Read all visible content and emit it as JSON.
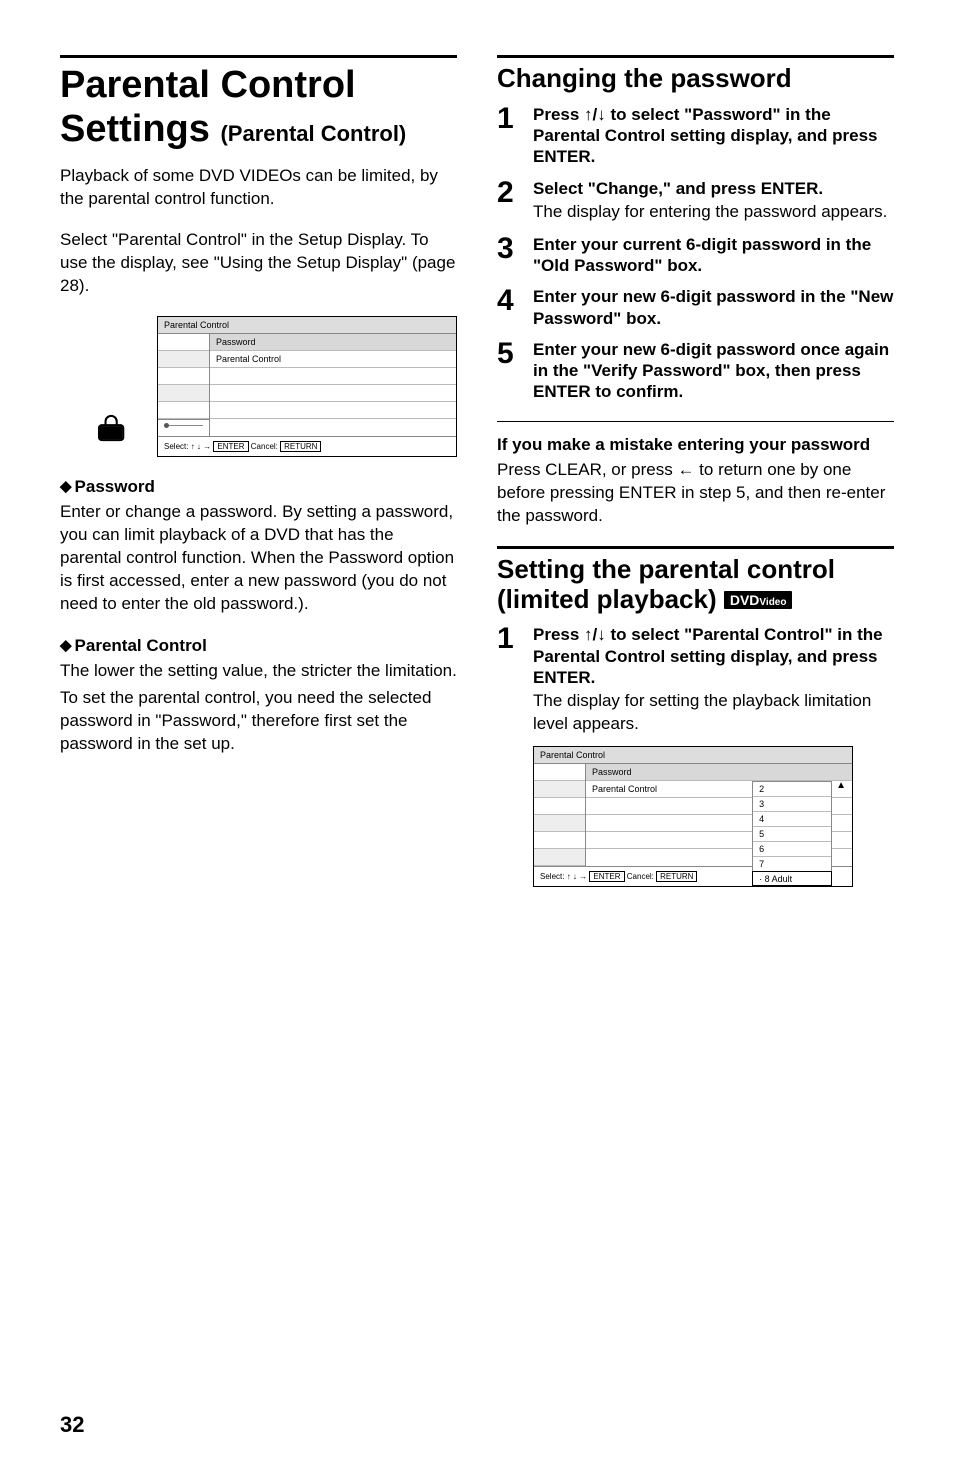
{
  "left": {
    "title_line1": "Parental Control",
    "title_line2": "Settings",
    "title_sub": "(Parental Control)",
    "para1": "Playback of some DVD VIDEOs can be limited, by the parental control function.",
    "para2": "Select \"Parental Control\" in the Setup Display. To use the display, see \"Using the Setup Display\" (page 28).",
    "box1": {
      "title": "Parental Control",
      "row1": "Password",
      "row2": "Parental Control",
      "footer_pre": "Select:",
      "footer_enter": "ENTER",
      "footer_cancel_label": "Cancel:",
      "footer_return": "RETURN"
    },
    "h_password": "Password",
    "password_body": "Enter or change a password. By setting a password, you can limit playback of a DVD that has the parental control function. When the Password option is first accessed, enter a new password (you do not need to enter the old password.).",
    "h_parental": "Parental Control",
    "parental_body1": "The lower the setting value, the stricter the limitation.",
    "parental_body2": "To set the parental control, you need the selected password in \"Password,\" therefore first set the password in the set up."
  },
  "right": {
    "h_changing": "Changing the password",
    "steps_a": [
      {
        "n": "1",
        "head": "Press ↑/↓ to select \"Password\" in the Parental Control setting display, and press ENTER."
      },
      {
        "n": "2",
        "head": "Select \"Change,\" and press ENTER.",
        "body": "The display for entering the password appears."
      },
      {
        "n": "3",
        "head": "Enter your current 6-digit password in the \"Old Password\" box."
      },
      {
        "n": "4",
        "head": "Enter your new 6-digit password in the \"New Password\" box."
      },
      {
        "n": "5",
        "head": "Enter your new 6-digit password once again in the \"Verify Password\" box, then press ENTER to confirm."
      }
    ],
    "mistake_h": "If you make a mistake entering your password",
    "mistake_body": "Press CLEAR, or press ← to return one by one before pressing ENTER in step 5, and then re-enter the password.",
    "h_setting1": "Setting the parental control",
    "h_setting2": "(limited playback)",
    "dvd_badge": "DVD",
    "dvd_badge_small": "Video",
    "steps_b": [
      {
        "n": "1",
        "head": "Press ↑/↓ to select \"Parental Control\" in the Parental Control setting display, and press ENTER.",
        "body": "The display for setting the playback limitation level appears."
      }
    ],
    "box2": {
      "title": "Parental Control",
      "row1": "Password",
      "row2": "Parental Control",
      "levels": [
        "2",
        "3",
        "4",
        "5",
        "6",
        "7"
      ],
      "level_sel_prefix": "·",
      "level_sel": "8  Adult",
      "tri": "▲",
      "footer_pre": "Select:",
      "footer_enter": "ENTER",
      "footer_cancel_label": "Cancel:",
      "footer_return": "RETURN"
    }
  },
  "page_number": "32",
  "glyphs": {
    "diamond": "◆",
    "arrows_updown": "↑ ↓",
    "arrow_right": "→"
  }
}
